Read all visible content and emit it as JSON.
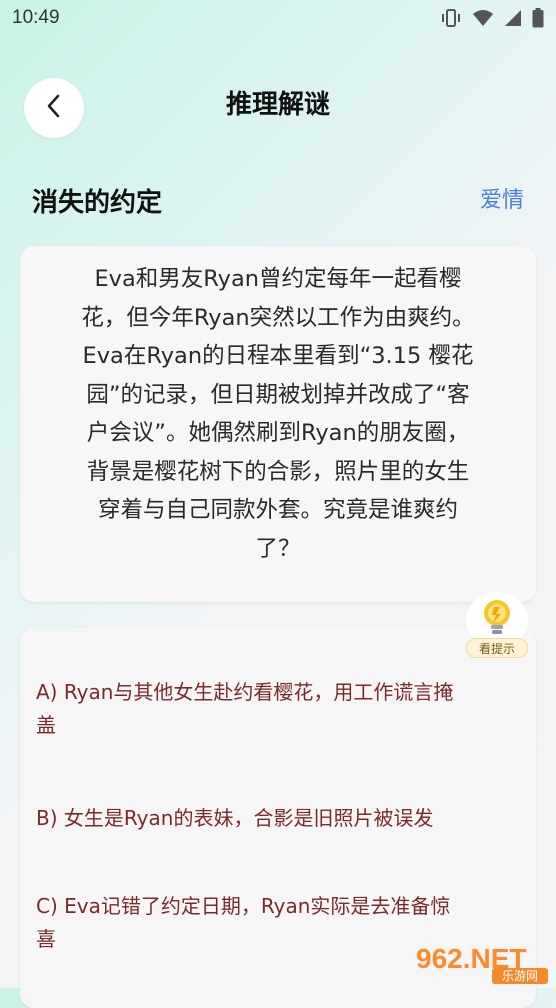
{
  "status_bar": {
    "time": "10:49",
    "icons": [
      "vibrate-icon",
      "wifi-icon",
      "signal-icon",
      "battery-icon"
    ]
  },
  "header": {
    "title": "推理解谜",
    "back_icon": "chevron-left-icon"
  },
  "puzzle": {
    "title": "消失的约定",
    "category": "爱情",
    "story_lines": [
      "Eva和男友Ryan曾约定每年一起看樱",
      "花，但今年Ryan突然以工作为由爽约。",
      "Eva在Ryan的日程本里看到“3.15 樱花",
      "园”的记录，但日期被划掉并改成了“客",
      "户会议”。她偶然刷到Ryan的朋友圈，",
      "背景是樱花树下的合影，照片里的女生",
      "穿着与自己同款外套。究竟是谁爽约",
      "了？"
    ]
  },
  "hint": {
    "label": "看提示",
    "icon": "lightbulb-icon"
  },
  "options": [
    {
      "line1": "A) Ryan与其他女生赴约看樱花，用工作谎言掩",
      "line2": "盖"
    },
    {
      "line1": "B) 女生是Ryan的表妹，合影是旧照片被误发",
      "line2": ""
    },
    {
      "line1": "C) Eva记错了约定日期，Ryan实际是去准备惊",
      "line2": "喜"
    }
  ],
  "watermark": {
    "big": "962.NET",
    "small": "乐游网"
  },
  "colors": {
    "accent_blue": "#4a7ee0",
    "option_text": "#7b2a2a",
    "hint_yellow": "#f7c52b"
  }
}
